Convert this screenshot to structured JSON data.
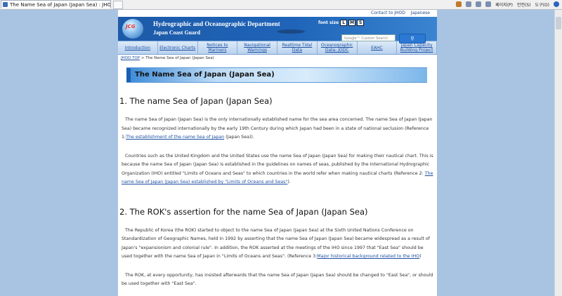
{
  "browser": {
    "tab_title": "The Name Sea of Japan (Japan Sea) : JHOD",
    "tools": {
      "page": "페이지(P)",
      "safety": "안전(S)",
      "tools": "도구(O)"
    }
  },
  "header": {
    "top_links": [
      "Contact to JHOD",
      "Japanese"
    ],
    "logo": "JCG",
    "dept_line1": "Hydrographic and Oceanographic Department",
    "dept_line2": "Japan Coast Guard",
    "font_size_label": "font size",
    "font_size_options": [
      "L",
      "M",
      "S"
    ],
    "search_placeholder": "Google™ Custom Search"
  },
  "nav": {
    "items": [
      "Introduction",
      "Electronic Charts",
      "Notices to Mariners",
      "Navigational Warnings",
      "Realtime Tidal Data",
      "Oceanographic Data: JODC",
      "EAHC",
      "Japan Capacity Building Project"
    ]
  },
  "breadcrumb": {
    "home": "JHOD TOP",
    "sep": " > ",
    "current": "The Name Sea of Japan (Japan Sea)"
  },
  "page_title": "The Name Sea of Japan (Japan Sea)",
  "section1": {
    "heading": "1. The name Sea of Japan (Japan Sea)",
    "p1_text": "The name Sea of Japan (Japan Sea) is the only internationally established name for the sea area concerned. The name Sea of Japan (Japan Sea) became recognized internationally by the early 19th Century during which Japan had been in a state of national seclusion (Reference 1:",
    "p1_link": "The establishment of the name Sea of Japan",
    "p1_tail": " (Japan Sea)).",
    "p2_text": "Countries such as the United Kingdom and the United States use the name Sea of Japan (Japan Sea) for making their nautical chart. This is because the name Sea of Japan (Japan Sea) is established in the guidelines on names of seas, published by the International Hydrographic Organization (IHO) entitled \"Limits of Oceans and Seas\" to which countries in the world refer when making nautical charts (Reference 2: ",
    "p2_link": "The name Sea of Japan (Japan Sea) established by \"Limits of Oceans and Seas\"",
    "p2_tail": ")."
  },
  "section2": {
    "heading": "2. The ROK's assertion for the name Sea of Japan (Japan Sea)",
    "p1_text": "The Republic of Korea (the ROK) started to object to the name Sea of Japan (Japan Sea) at the Sixth United Nations Conference on Standardization of Geographic Names, held in 1992 by asserting that the name Sea of Japan (Japan Sea) became widespread as a result of Japan's \"expansionism and colonial rule\". In addition, the ROK asserted at the meetings of the IHO since 1997 that \"East Sea\" should be used together with the name Sea of Japan in \"Limits of Oceans and Seas\". (Reference 3:",
    "p1_link": "Major historical background related to the IHO",
    "p1_tail": ")",
    "p2_text": "The ROK, at every opportunity, has insisted afterwards that the name Sea of Japan (Japan Sea) should be changed to \"East Sea\", or should be used together with \"East Sea\"."
  }
}
